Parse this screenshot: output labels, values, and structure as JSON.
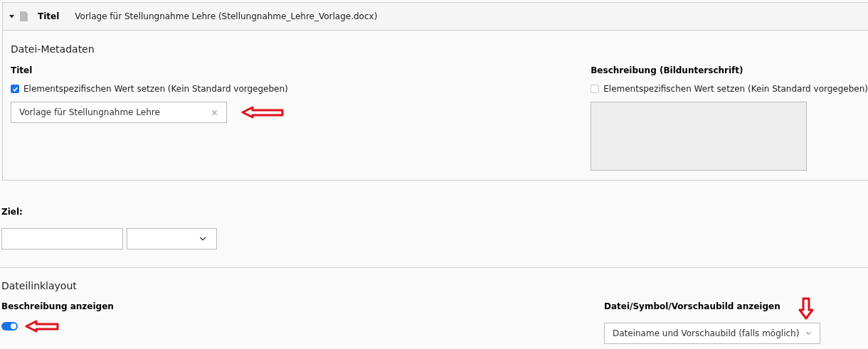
{
  "header": {
    "expanded": true,
    "label": "Titel",
    "title": "Vorlage für Stellungnahme Lehre (Stellungnahme_Lehre_Vorlage.docx)"
  },
  "metadata": {
    "heading": "Datei-Metadaten",
    "fields": [
      {
        "kind": "text",
        "label": "Titel",
        "override_label": "Elementspezifischen Wert setzen (Kein Standard vorgegeben)",
        "checked": true,
        "value": "Vorlage für Stellungnahme Lehre"
      },
      {
        "kind": "textarea",
        "label": "Beschreibung (Bildunterschrift)",
        "override_label": "Elementspezifischen Wert setzen (Kein Standard vorgegeben)",
        "checked": false
      }
    ]
  },
  "target": {
    "label": "Ziel:"
  },
  "layout": {
    "heading": "Dateilinklayout",
    "description": {
      "label": "Beschreibung anzeigen",
      "on": true
    },
    "display": {
      "label": "Datei/Symbol/Vorschaubild anzeigen",
      "value": "Dateiname und Vorschaubild (falls möglich)"
    }
  }
}
